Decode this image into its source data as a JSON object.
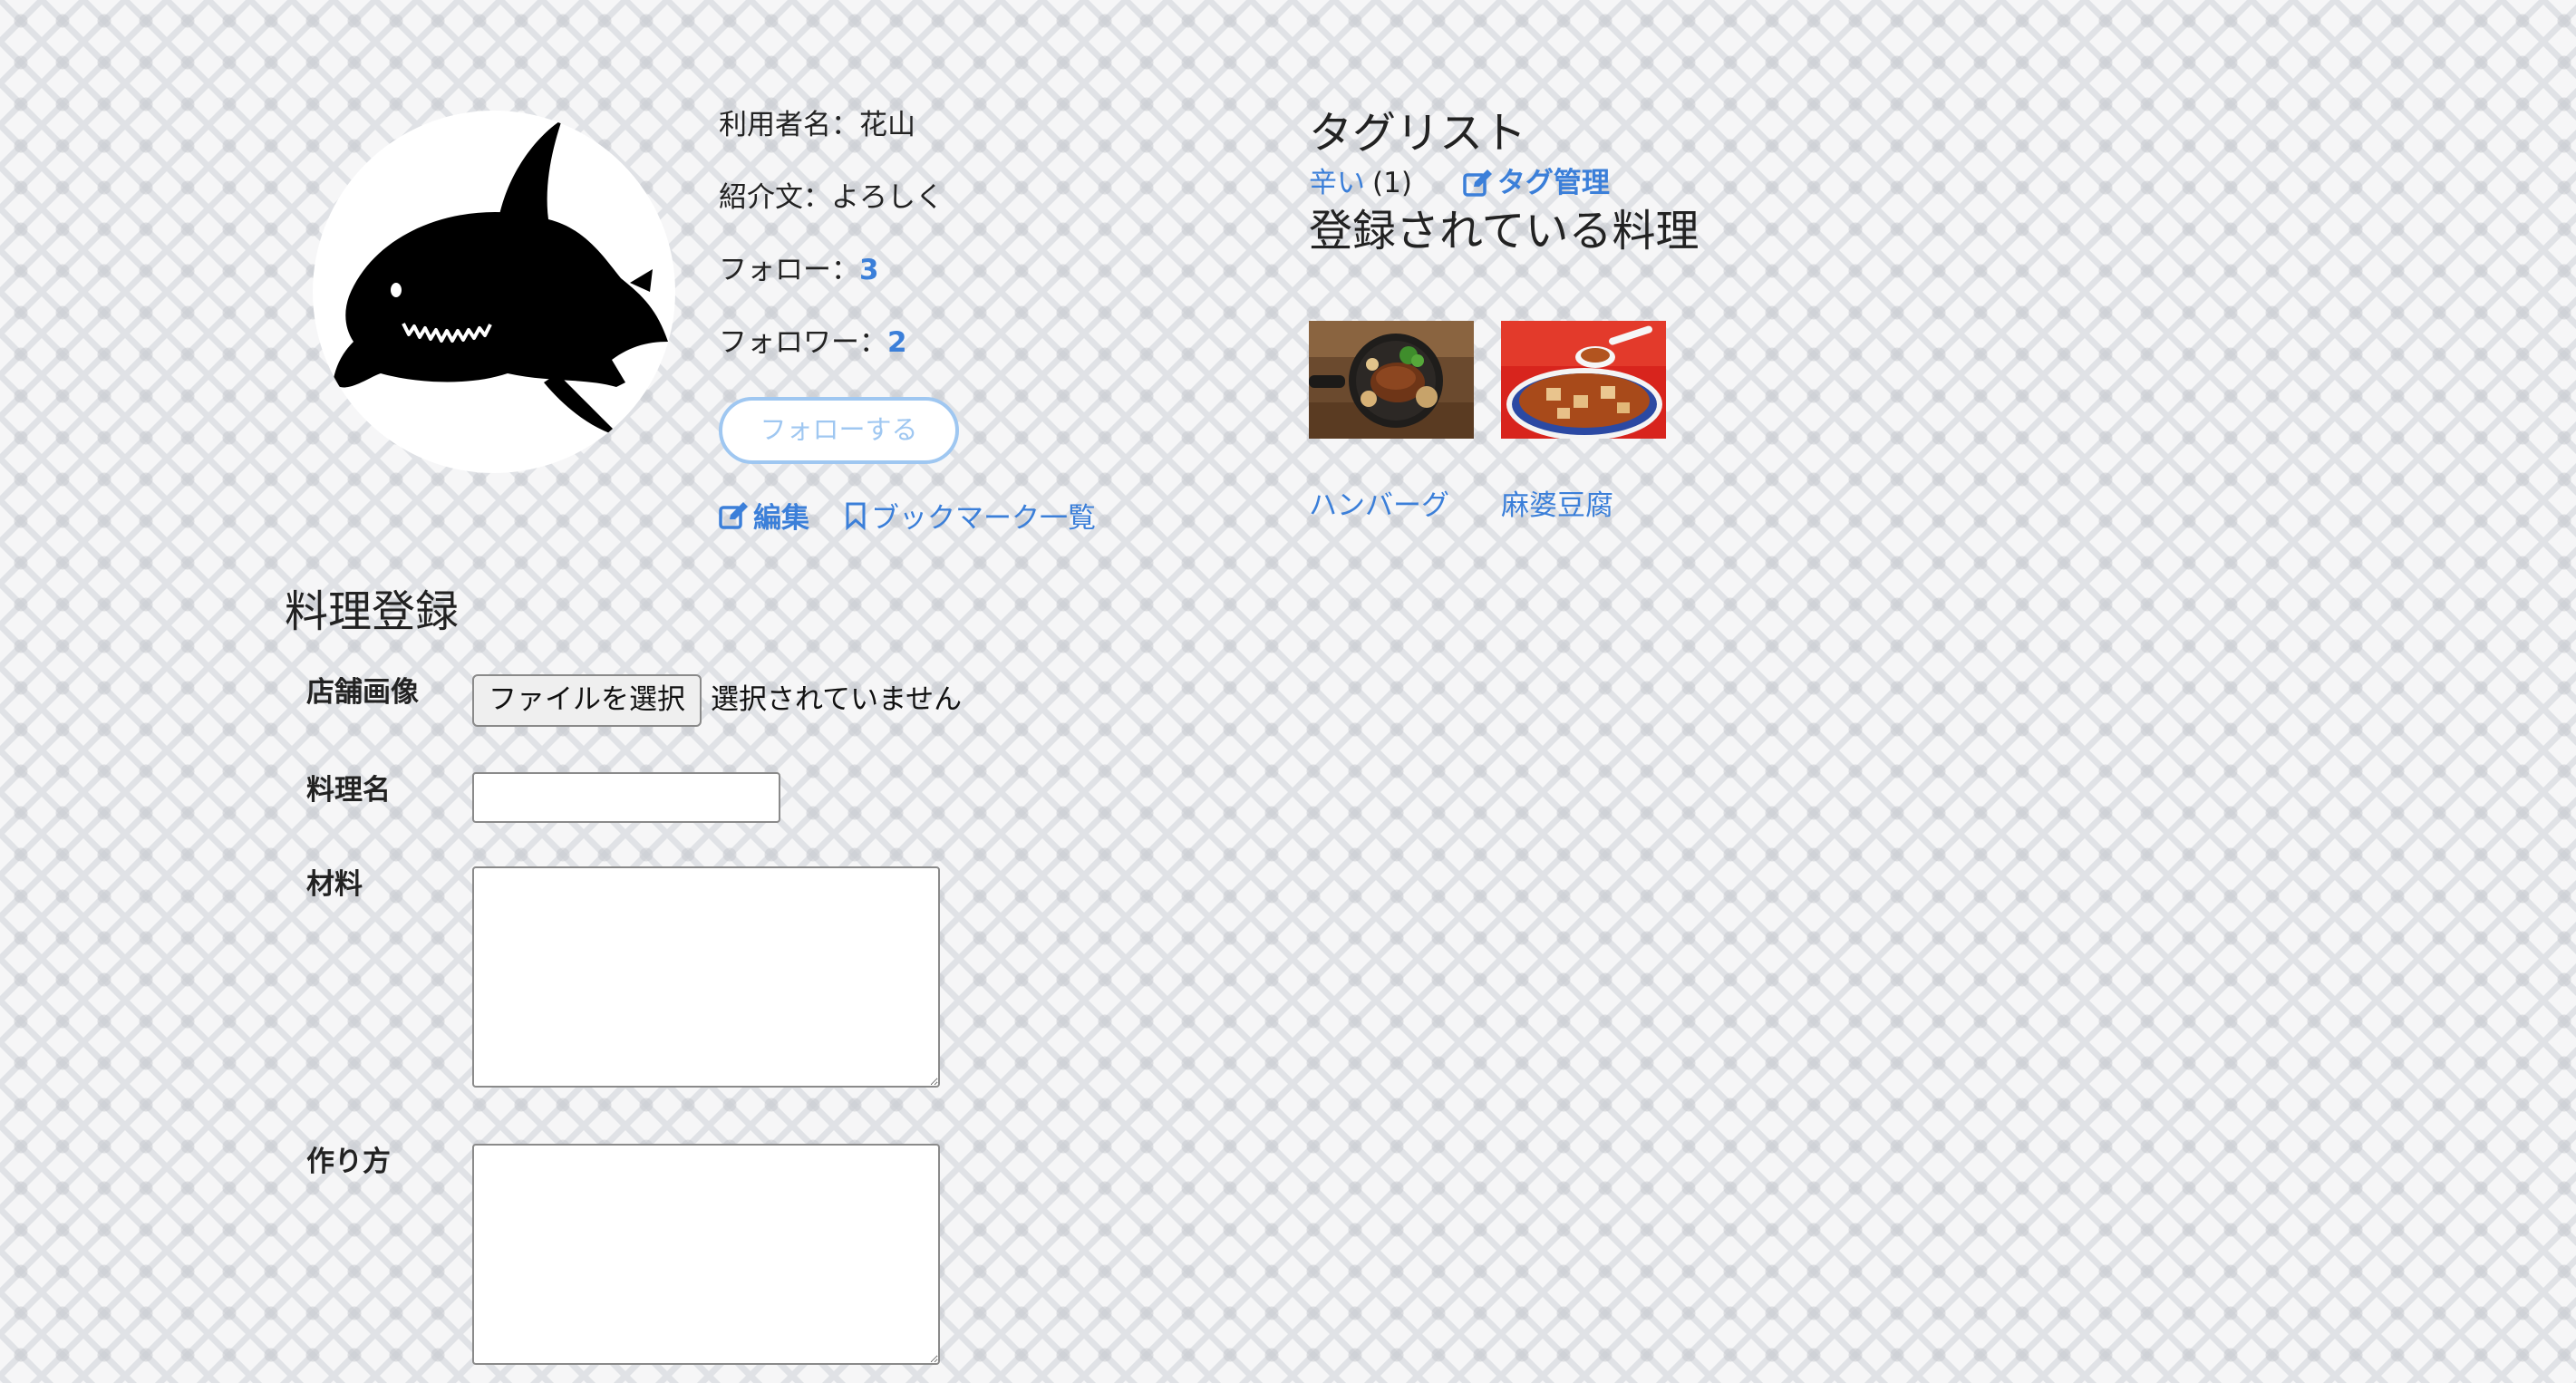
{
  "profile": {
    "username_label": "利用者名：花山",
    "intro_label": "紹介文：よろしく",
    "follow_label": "フォロー：",
    "follow_count": "3",
    "follower_label": "フォロワー：",
    "follower_count": "2",
    "follow_button": "フォローする",
    "edit_link": "編集",
    "bookmark_link": "ブックマーク一覧",
    "avatar_icon": "shark-silhouette"
  },
  "tags": {
    "heading": "タグリスト",
    "items": [
      {
        "name": "辛い",
        "count": "(1)"
      }
    ],
    "manage_link": "タグ管理"
  },
  "dishes": {
    "heading": "登録されている料理",
    "items": [
      {
        "name": "ハンバーグ",
        "image": "hamburg-steak-photo"
      },
      {
        "name": "麻婆豆腐",
        "image": "mapo-tofu-photo"
      }
    ]
  },
  "form": {
    "title": "料理登録",
    "image_label": "店舗画像",
    "file_button": "ファイルを選択",
    "file_status": "選択されていません",
    "name_label": "料理名",
    "name_value": "",
    "ingredients_label": "材料",
    "ingredients_value": "",
    "steps_label": "作り方",
    "steps_value": ""
  },
  "colors": {
    "link": "#3b7fd9",
    "follow_button_border": "#9fc7f1"
  }
}
